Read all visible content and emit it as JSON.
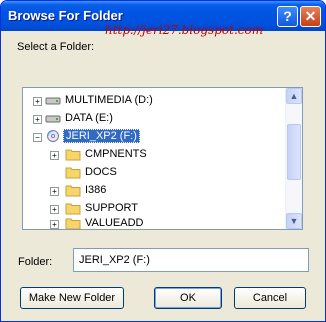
{
  "window": {
    "title": "Browse For Folder",
    "help_glyph": "?",
    "close_glyph": "✕"
  },
  "watermark": "http://jeri27.blogspot.com",
  "prompt": "Select a Folder:",
  "tree": {
    "items": [
      {
        "label": "MULTIMEDIA (D:)",
        "icon": "drive-icon",
        "expander": "+"
      },
      {
        "label": "DATA (E:)",
        "icon": "drive-icon",
        "expander": "+"
      },
      {
        "label": "JERI_XP2 (F:)",
        "icon": "cd-drive-icon",
        "expander": "−"
      },
      {
        "label": "CMPNENTS",
        "icon": "folder-icon",
        "expander": "+"
      },
      {
        "label": "DOCS",
        "icon": "folder-icon",
        "expander": ""
      },
      {
        "label": "I386",
        "icon": "folder-icon",
        "expander": "+"
      },
      {
        "label": "SUPPORT",
        "icon": "folder-icon",
        "expander": "+"
      },
      {
        "label": "VALUEADD",
        "icon": "folder-icon",
        "expander": "+"
      }
    ]
  },
  "folder_field": {
    "label": "Folder:",
    "value": "JERI_XP2 (F:)"
  },
  "buttons": {
    "make_new_folder": "Make New Folder",
    "ok": "OK",
    "cancel": "Cancel"
  },
  "colors": {
    "titlebar": "#0054e3",
    "selection": "#316ac5",
    "watermark": "#c00000"
  }
}
